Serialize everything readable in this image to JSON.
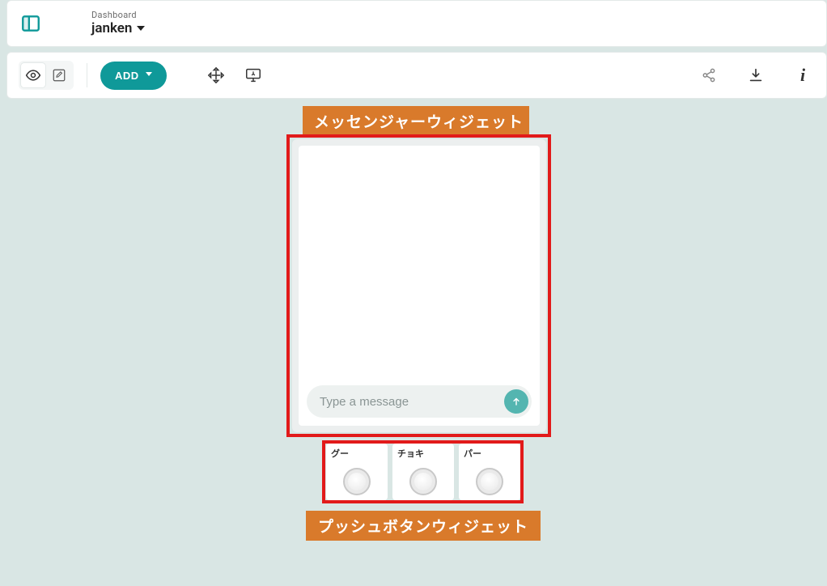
{
  "header": {
    "subtitle": "Dashboard",
    "title": "janken"
  },
  "toolbar": {
    "add_label": "ADD"
  },
  "icons": {
    "sidebar": "panel-left-icon",
    "eye": "eye-icon",
    "pencil": "edit-icon",
    "chevron_down": "chevron-down-icon",
    "move": "move-icon",
    "monitor": "monitor-icon",
    "share": "share-icon",
    "download": "download-icon",
    "info": "info-icon",
    "send_arrow": "arrow-up-icon"
  },
  "annotations": {
    "messenger_label": "メッセンジャーウィジェット",
    "pushbutton_label": "プッシュボタンウィジェット"
  },
  "messenger": {
    "input_placeholder": "Type a message"
  },
  "push_buttons": [
    {
      "label": "グー"
    },
    {
      "label": "チョキ"
    },
    {
      "label": "パー"
    }
  ],
  "colors": {
    "accent": "#0f9999",
    "canvas_bg": "#d9e6e4",
    "callout_bg": "#d97a2b",
    "highlight_border": "#e21a1a"
  }
}
